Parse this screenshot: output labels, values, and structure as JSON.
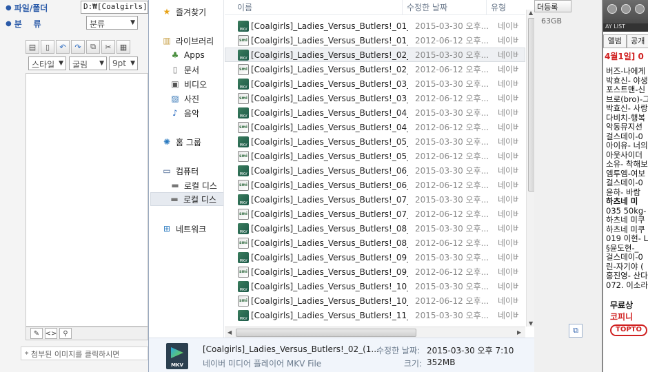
{
  "editor": {
    "folder_label": "파일/폴더",
    "folder_path": "D:₩[Coalgirls]",
    "category_label": "분    류",
    "category_select": "분류",
    "style_select": "스타일",
    "font_select": "굴림",
    "size_select": "9pt",
    "attach_note": "* 첨부된 이미지를 클릭하시면"
  },
  "nav": {
    "favorites": "즐겨찾기",
    "libraries": "라이브러리",
    "apps": "Apps",
    "documents": "문서",
    "videos": "비디오",
    "pictures": "사진",
    "music": "음악",
    "homegroup": "홈 그룹",
    "computer": "컴퓨터",
    "local_disk_1": "로컬 디스",
    "local_disk_2": "로컬 디스",
    "network": "네트워크"
  },
  "columns": {
    "name": "이름",
    "date": "수정한 날짜",
    "type": "유형"
  },
  "files": [
    {
      "name": "[Coalgirls]_Ladies_Versus_Butlers!_01_(1...",
      "date": "2015-03-30 오후...",
      "type": "네이버",
      "icon": "mkv"
    },
    {
      "name": "[Coalgirls]_Ladies_Versus_Butlers!_01_(1...",
      "date": "2012-06-12 오후...",
      "type": "네이버",
      "icon": "smi"
    },
    {
      "name": "[Coalgirls]_Ladies_Versus_Butlers!_02_(1...",
      "date": "2015-03-30 오후...",
      "type": "네이버",
      "icon": "mkv"
    },
    {
      "name": "[Coalgirls]_Ladies_Versus_Butlers!_02_(1...",
      "date": "2012-06-12 오후...",
      "type": "네이버",
      "icon": "smi"
    },
    {
      "name": "[Coalgirls]_Ladies_Versus_Butlers!_03_(1...",
      "date": "2015-03-30 오후...",
      "type": "네이버",
      "icon": "mkv"
    },
    {
      "name": "[Coalgirls]_Ladies_Versus_Butlers!_03_(1...",
      "date": "2012-06-12 오후...",
      "type": "네이버",
      "icon": "smi"
    },
    {
      "name": "[Coalgirls]_Ladies_Versus_Butlers!_04_(1...",
      "date": "2015-03-30 오후...",
      "type": "네이버",
      "icon": "mkv"
    },
    {
      "name": "[Coalgirls]_Ladies_Versus_Butlers!_04_(1...",
      "date": "2012-06-12 오후...",
      "type": "네이버",
      "icon": "smi"
    },
    {
      "name": "[Coalgirls]_Ladies_Versus_Butlers!_05_(1...",
      "date": "2015-03-30 오후...",
      "type": "네이버",
      "icon": "mkv"
    },
    {
      "name": "[Coalgirls]_Ladies_Versus_Butlers!_05_(1...",
      "date": "2012-06-12 오후...",
      "type": "네이버",
      "icon": "smi"
    },
    {
      "name": "[Coalgirls]_Ladies_Versus_Butlers!_06_(1...",
      "date": "2015-03-30 오후...",
      "type": "네이버",
      "icon": "mkv"
    },
    {
      "name": "[Coalgirls]_Ladies_Versus_Butlers!_06_(1...",
      "date": "2012-06-12 오후...",
      "type": "네이버",
      "icon": "smi"
    },
    {
      "name": "[Coalgirls]_Ladies_Versus_Butlers!_07_(1...",
      "date": "2015-03-30 오후...",
      "type": "네이버",
      "icon": "mkv"
    },
    {
      "name": "[Coalgirls]_Ladies_Versus_Butlers!_07_(1...",
      "date": "2012-06-12 오후...",
      "type": "네이버",
      "icon": "smi"
    },
    {
      "name": "[Coalgirls]_Ladies_Versus_Butlers!_08_(1...",
      "date": "2015-03-30 오후...",
      "type": "네이버",
      "icon": "mkv"
    },
    {
      "name": "[Coalgirls]_Ladies_Versus_Butlers!_08_(1...",
      "date": "2012-06-12 오후...",
      "type": "네이버",
      "icon": "smi"
    },
    {
      "name": "[Coalgirls]_Ladies_Versus_Butlers!_09_(1...",
      "date": "2015-03-30 오후...",
      "type": "네이버",
      "icon": "mkv"
    },
    {
      "name": "[Coalgirls]_Ladies_Versus_Butlers!_09_(1...",
      "date": "2012-06-12 오후...",
      "type": "네이버",
      "icon": "smi"
    },
    {
      "name": "[Coalgirls]_Ladies_Versus_Butlers!_10_(1...",
      "date": "2015-03-30 오후...",
      "type": "네이버",
      "icon": "mkv"
    },
    {
      "name": "[Coalgirls]_Ladies_Versus_Butlers!_10_(1...",
      "date": "2012-06-12 오후...",
      "type": "네이버",
      "icon": "smi"
    },
    {
      "name": "[Coalgirls]_Ladies_Versus_Butlers!_11_(1...",
      "date": "2015-03-30 오후...",
      "type": "네이버",
      "icon": "mkv"
    }
  ],
  "details": {
    "filename": "[Coalgirls]_Ladies_Versus_Butlers!_02_(1...",
    "filetype": "네이버 미디어 플레이어 MKV File",
    "modified_label": "수정한 날짜:",
    "modified_value": "2015-03-30 오후 7:10",
    "size_label": "크기:",
    "size_value": "352MB",
    "icon_label": "MKV"
  },
  "right": {
    "register_btn": "더등록",
    "size_text": "63GB",
    "playlist": "AY LIST",
    "tab1": "앨범",
    "tab2": "공개",
    "date_title": "4월1일] 0",
    "items": [
      {
        "t": "버즈-나에게",
        "b": false
      },
      {
        "t": "박효신- 야생",
        "b": false
      },
      {
        "t": "포스트맨-신",
        "b": false
      },
      {
        "t": "브로(bro)-그",
        "b": false
      },
      {
        "t": "박효신- 사랑",
        "b": false
      },
      {
        "t": "다비치-행복",
        "b": false
      },
      {
        "t": "악동뮤지션",
        "b": false
      },
      {
        "t": "걸스데이-0",
        "b": false
      },
      {
        "t": "아이유- 너의",
        "b": false
      },
      {
        "t": "아웃사이더",
        "b": false
      },
      {
        "t": "소유- 착해보",
        "b": false
      },
      {
        "t": "엠투엠-여보",
        "b": false
      },
      {
        "t": "걸스데이-0",
        "b": false
      },
      {
        "t": "윤하- 바람",
        "b": false
      },
      {
        "t": " 하츠네 미",
        "b": true
      },
      {
        "t": "035 50kg- ≠",
        "b": false
      },
      {
        "t": "하츠네 미쿠",
        "b": false
      },
      {
        "t": "하츠네 미쿠",
        "b": false
      },
      {
        "t": "019 이현- L",
        "b": false
      },
      {
        "t": "§윤도현-_",
        "b": false
      },
      {
        "t": "걸스데이-0",
        "b": false
      },
      {
        "t": "린-자기야 (",
        "b": false
      },
      {
        "t": "홍진영- 산다",
        "b": false
      },
      {
        "t": "072. 이소라",
        "b": false
      }
    ],
    "ad_line1": "무료상",
    "ad_line2": "코피니",
    "ad_logo": "TOPTO"
  }
}
